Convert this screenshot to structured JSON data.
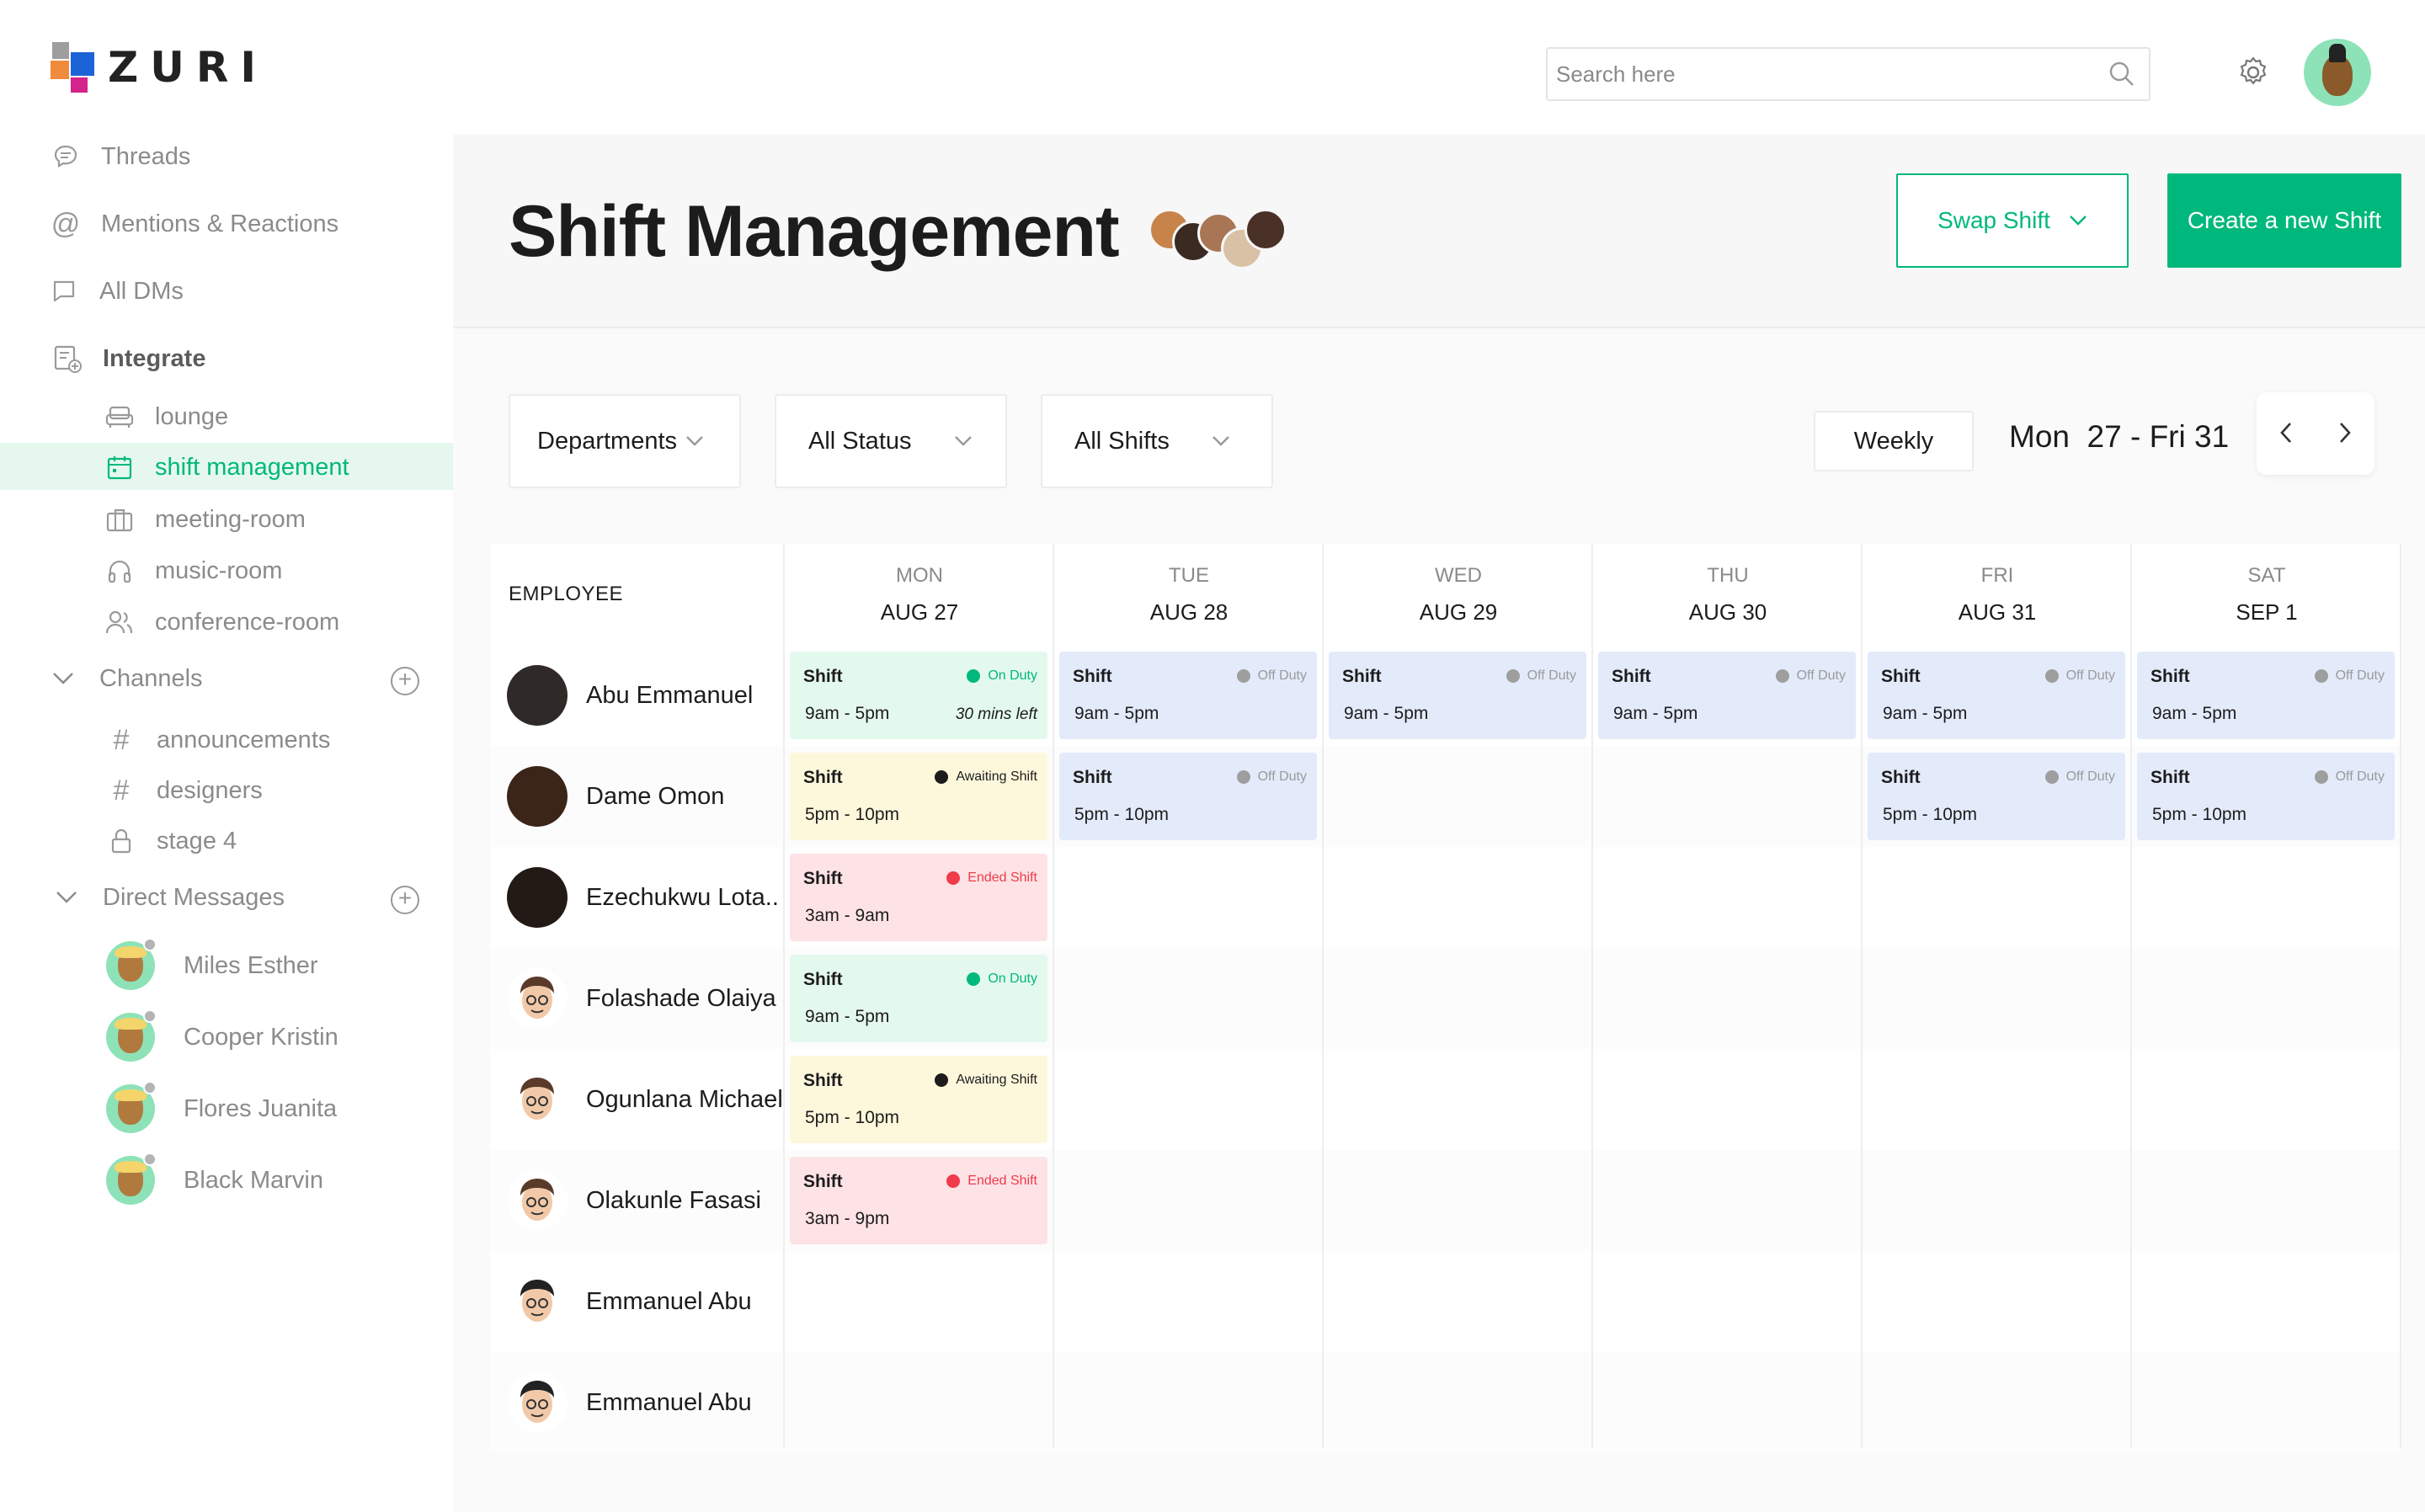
{
  "brand": {
    "name": "ZURI"
  },
  "sidebar": {
    "nav": [
      {
        "label": "Threads",
        "icon": "threads-icon"
      },
      {
        "label": "Mentions & Reactions",
        "icon": "at-icon"
      },
      {
        "label": "All DMs",
        "icon": "chat-bubble-icon"
      },
      {
        "label": "Integrate",
        "icon": "integrate-icon"
      }
    ],
    "integrations": [
      {
        "label": "lounge",
        "icon": "sofa-icon"
      },
      {
        "label": "shift management",
        "icon": "calendar-icon",
        "active": true
      },
      {
        "label": "meeting-room",
        "icon": "briefcase-icon"
      },
      {
        "label": "music-room",
        "icon": "headphones-icon"
      },
      {
        "label": "conference-room",
        "icon": "users-icon"
      }
    ],
    "channels_label": "Channels",
    "channels": [
      {
        "label": "announcements",
        "icon": "hash-icon"
      },
      {
        "label": "designers",
        "icon": "hash-icon"
      },
      {
        "label": "stage 4",
        "icon": "lock-icon"
      }
    ],
    "dms_label": "Direct Messages",
    "dms": [
      {
        "label": "Miles Esther"
      },
      {
        "label": "Cooper Kristin"
      },
      {
        "label": "Flores Juanita"
      },
      {
        "label": "Black Marvin"
      }
    ]
  },
  "topbar": {
    "search_placeholder": "Search here"
  },
  "page": {
    "title": "Shift Management",
    "swap_label": "Swap Shift",
    "create_label": "Create a new Shift"
  },
  "filters": {
    "departments": "Departments",
    "status": "All Status",
    "shifts": "All Shifts",
    "view": "Weekly",
    "date_range": "Mon  27 - Fri 31"
  },
  "table": {
    "employee_header": "EMPLOYEE",
    "days": [
      {
        "day": "MON",
        "date": "AUG 27"
      },
      {
        "day": "TUE",
        "date": "AUG 28"
      },
      {
        "day": "WED",
        "date": "AUG 29"
      },
      {
        "day": "THU",
        "date": "AUG 30"
      },
      {
        "day": "FRI",
        "date": "AUG 31"
      },
      {
        "day": "SAT",
        "date": "SEP 1"
      }
    ],
    "employees": [
      {
        "name": "Abu Emmanuel"
      },
      {
        "name": "Dame Omon"
      },
      {
        "name": "Ezechukwu Lota.."
      },
      {
        "name": "Folashade Olaiya"
      },
      {
        "name": "Ogunlana Michael"
      },
      {
        "name": "Olakunle Fasasi"
      },
      {
        "name": "Emmanuel Abu"
      },
      {
        "name": "Emmanuel Abu"
      }
    ],
    "shift_label": "Shift",
    "shifts": [
      {
        "row": 0,
        "col": 0,
        "status": "On Duty",
        "time": "9am - 5pm",
        "extra": "30 mins left",
        "kind": "green"
      },
      {
        "row": 0,
        "col": 1,
        "status": "Off Duty",
        "time": "9am - 5pm",
        "kind": "blue"
      },
      {
        "row": 0,
        "col": 2,
        "status": "Off Duty",
        "time": "9am - 5pm",
        "kind": "blue"
      },
      {
        "row": 0,
        "col": 3,
        "status": "Off Duty",
        "time": "9am - 5pm",
        "kind": "blue"
      },
      {
        "row": 0,
        "col": 4,
        "status": "Off Duty",
        "time": "9am - 5pm",
        "kind": "blue"
      },
      {
        "row": 0,
        "col": 5,
        "status": "Off Duty",
        "time": "9am - 5pm",
        "kind": "blue"
      },
      {
        "row": 1,
        "col": 0,
        "status": "Awaiting Shift",
        "time": "5pm - 10pm",
        "kind": "yellow"
      },
      {
        "row": 1,
        "col": 1,
        "status": "Off Duty",
        "time": "5pm - 10pm",
        "kind": "blue"
      },
      {
        "row": 1,
        "col": 4,
        "status": "Off Duty",
        "time": "5pm - 10pm",
        "kind": "blue"
      },
      {
        "row": 1,
        "col": 5,
        "status": "Off Duty",
        "time": "5pm - 10pm",
        "kind": "blue"
      },
      {
        "row": 2,
        "col": 0,
        "status": "Ended Shift",
        "time": "3am - 9am",
        "kind": "red"
      },
      {
        "row": 3,
        "col": 0,
        "status": "On Duty",
        "time": "9am - 5pm",
        "kind": "green"
      },
      {
        "row": 4,
        "col": 0,
        "status": "Awaiting Shift",
        "time": "5pm - 10pm",
        "kind": "yellow"
      },
      {
        "row": 5,
        "col": 0,
        "status": "Ended Shift",
        "time": "3am - 9pm",
        "kind": "red"
      }
    ]
  },
  "colors": {
    "accent": "#00b87c",
    "on_duty": "#00b87c",
    "off_duty": "#9e9e9e",
    "awaiting": "#1d1c1d",
    "ended": "#ef3b4a"
  }
}
